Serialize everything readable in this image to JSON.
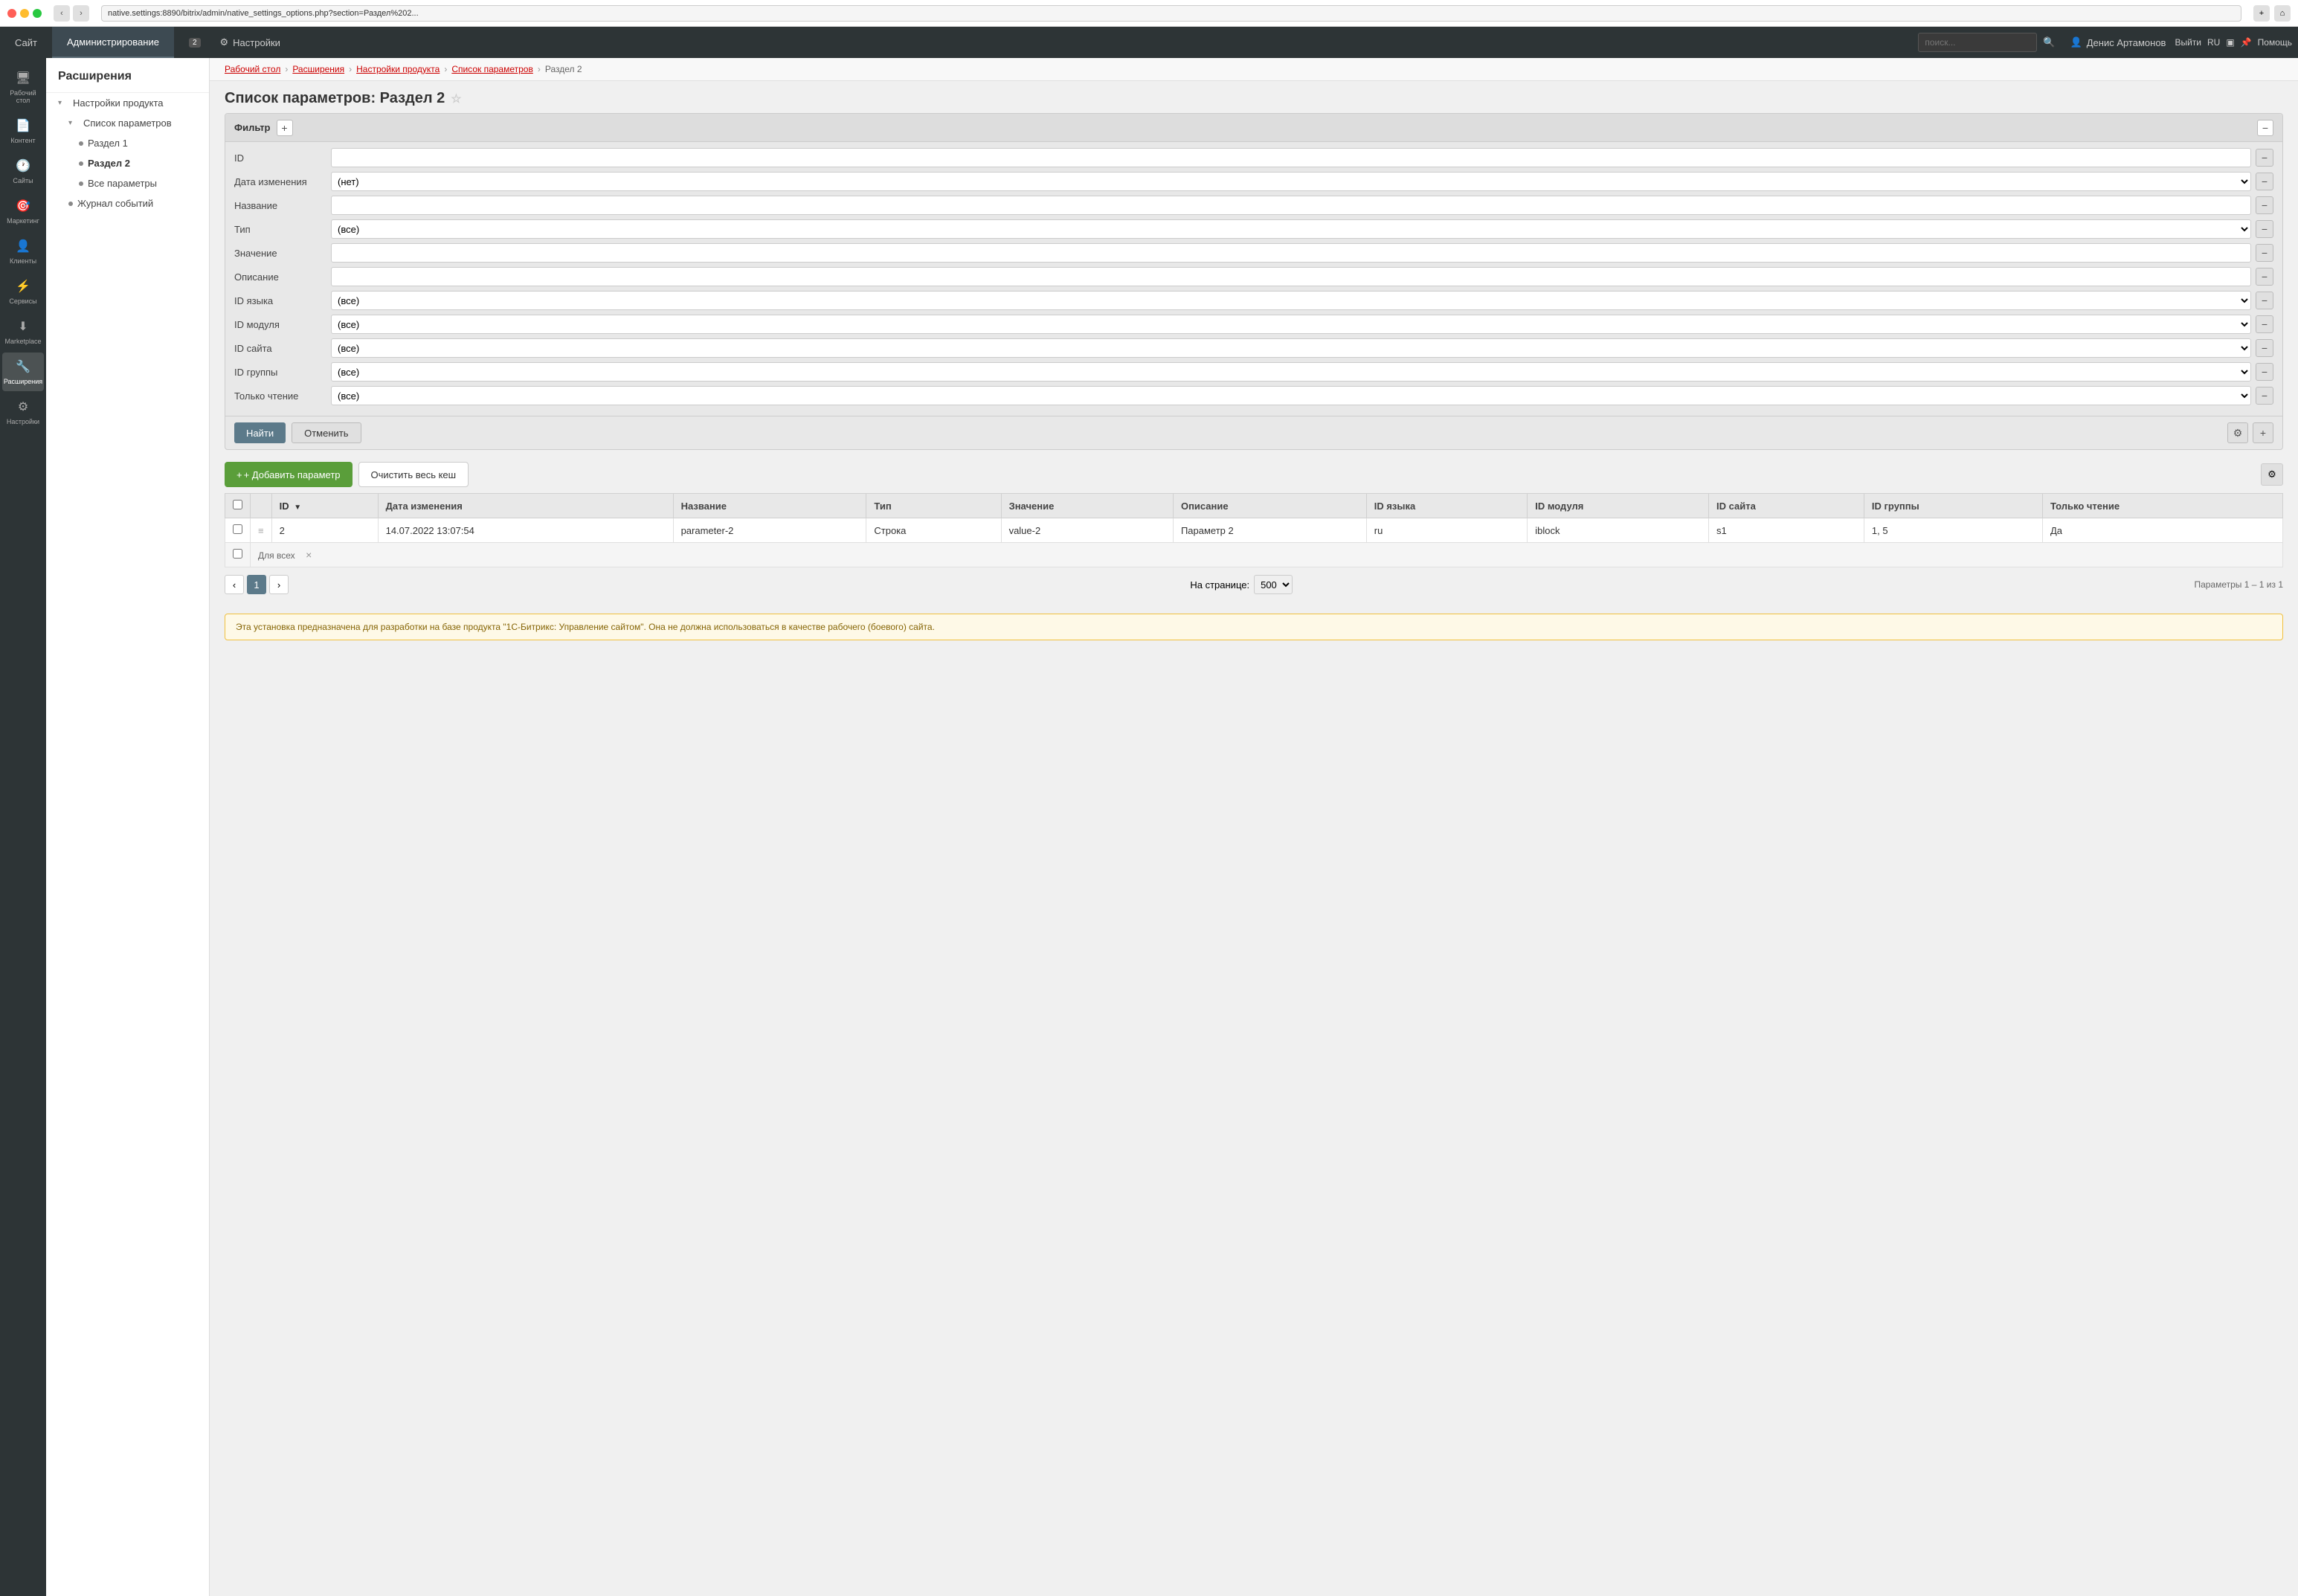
{
  "browser": {
    "url": "native.settings:8890/bitrix/admin/native_settings_options.php?section=Раздел%202...",
    "back_label": "‹",
    "forward_label": "›"
  },
  "header": {
    "site_label": "Сайт",
    "admin_label": "Администрирование",
    "tab_notifications_label": "2",
    "tab_settings_label": "Настройки",
    "search_placeholder": "поиск...",
    "user_label": "Денис Артамонов",
    "logout_label": "Выйти",
    "lang_label": "RU",
    "help_label": "Помощь"
  },
  "left_nav": {
    "items": [
      {
        "id": "desktop",
        "label": "Рабочий стол",
        "icon": "🖥"
      },
      {
        "id": "content",
        "label": "Контент",
        "icon": "📄"
      },
      {
        "id": "sites",
        "label": "Сайты",
        "icon": "🕐"
      },
      {
        "id": "marketing",
        "label": "Маркетинг",
        "icon": "🎯"
      },
      {
        "id": "clients",
        "label": "Клиенты",
        "icon": "👤"
      },
      {
        "id": "services",
        "label": "Сервисы",
        "icon": "⚡"
      },
      {
        "id": "marketplace",
        "label": "Marketplace",
        "icon": "⬇"
      },
      {
        "id": "extensions",
        "label": "Расширения",
        "icon": "🔧"
      },
      {
        "id": "settings",
        "label": "Настройки",
        "icon": "⚙"
      }
    ]
  },
  "second_sidebar": {
    "title": "Расширения",
    "items": [
      {
        "id": "product-settings",
        "label": "Настройки продукта",
        "level": 0,
        "type": "parent",
        "collapsed": false
      },
      {
        "id": "params-list",
        "label": "Список параметров",
        "level": 1,
        "type": "parent",
        "collapsed": false
      },
      {
        "id": "section1",
        "label": "Раздел 1",
        "level": 2,
        "type": "leaf"
      },
      {
        "id": "section2",
        "label": "Раздел 2",
        "level": 2,
        "type": "leaf",
        "active": true
      },
      {
        "id": "all-params",
        "label": "Все параметры",
        "level": 2,
        "type": "leaf"
      },
      {
        "id": "event-log",
        "label": "Журнал событий",
        "level": 1,
        "type": "leaf"
      }
    ]
  },
  "breadcrumb": {
    "items": [
      {
        "label": "Рабочий стол",
        "link": true
      },
      {
        "label": "Расширения",
        "link": true
      },
      {
        "label": "Настройки продукта",
        "link": true
      },
      {
        "label": "Список параметров",
        "link": true
      },
      {
        "label": "Раздел 2",
        "link": false
      }
    ]
  },
  "page": {
    "title": "Список параметров: Раздел 2"
  },
  "filter": {
    "title": "Фильтр",
    "add_label": "+",
    "minimize_label": "−",
    "fields": [
      {
        "id": "id",
        "label": "ID",
        "type": "text",
        "value": ""
      },
      {
        "id": "date_changed",
        "label": "Дата изменения",
        "type": "select",
        "value": "(нет)",
        "options": [
          "(нет)"
        ]
      },
      {
        "id": "name",
        "label": "Название",
        "type": "text",
        "value": ""
      },
      {
        "id": "type",
        "label": "Тип",
        "type": "select",
        "value": "(все)",
        "options": [
          "(все)"
        ]
      },
      {
        "id": "value",
        "label": "Значение",
        "type": "text",
        "value": ""
      },
      {
        "id": "description",
        "label": "Описание",
        "type": "text",
        "value": ""
      },
      {
        "id": "lang_id",
        "label": "ID языка",
        "type": "select",
        "value": "(все)",
        "options": [
          "(все)"
        ]
      },
      {
        "id": "module_id",
        "label": "ID модуля",
        "type": "select",
        "value": "(все)",
        "options": [
          "(все)"
        ]
      },
      {
        "id": "site_id",
        "label": "ID сайта",
        "type": "select",
        "value": "(все)",
        "options": [
          "(все)"
        ]
      },
      {
        "id": "group_id",
        "label": "ID группы",
        "type": "select",
        "value": "(все)",
        "options": [
          "(все)"
        ]
      },
      {
        "id": "readonly",
        "label": "Только чтение",
        "type": "select",
        "value": "(все)",
        "options": [
          "(все)"
        ]
      }
    ],
    "find_label": "Найти",
    "cancel_label": "Отменить"
  },
  "table": {
    "add_btn_label": "+ Добавить параметр",
    "clear_cache_label": "Очистить весь кеш",
    "columns": [
      {
        "id": "check",
        "label": ""
      },
      {
        "id": "drag",
        "label": ""
      },
      {
        "id": "id",
        "label": "ID",
        "sorted": true,
        "sort_dir": "▼"
      },
      {
        "id": "date_changed",
        "label": "Дата изменения"
      },
      {
        "id": "name",
        "label": "Название"
      },
      {
        "id": "type",
        "label": "Тип"
      },
      {
        "id": "value",
        "label": "Значение"
      },
      {
        "id": "description",
        "label": "Описание"
      },
      {
        "id": "lang_id",
        "label": "ID языка"
      },
      {
        "id": "module_id",
        "label": "ID модуля"
      },
      {
        "id": "site_id",
        "label": "ID сайта"
      },
      {
        "id": "group_id",
        "label": "ID группы"
      },
      {
        "id": "readonly",
        "label": "Только чтение"
      }
    ],
    "rows": [
      {
        "id": "2",
        "date_changed": "14.07.2022 13:07:54",
        "name": "parameter-2",
        "type": "Строка",
        "value": "value-2",
        "description": "Параметр 2",
        "lang_id": "ru",
        "module_id": "iblock",
        "site_id": "s1",
        "group_id": "1, 5",
        "readonly": "Да"
      }
    ],
    "for_all_label": "Для всех",
    "for_all_x": "×"
  },
  "pagination": {
    "prev_label": "‹",
    "current_page": "1",
    "next_label": "›",
    "per_page_label": "На странице:",
    "per_page_value": "500",
    "info_label": "Параметры 1 – 1 из 1"
  },
  "warning": {
    "text": "Эта установка предназначена для разработки на базе продукта \"1С-Битрикс: Управление сайтом\". Она не должна использоваться в качестве рабочего (боевого) сайта."
  }
}
